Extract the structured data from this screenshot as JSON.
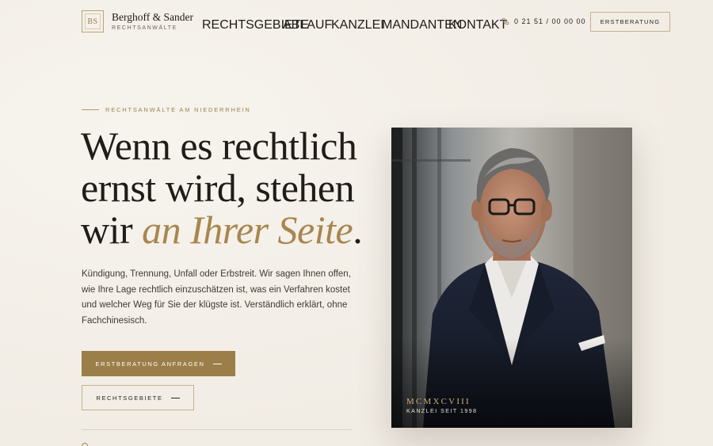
{
  "brand": {
    "monogram": "BS",
    "name": "Berghoff & Sander",
    "tagline": "RECHTSANWÄLTE"
  },
  "nav": {
    "items": [
      {
        "label": "RECHTSGEBIETE"
      },
      {
        "label": "ABLAUF"
      },
      {
        "label": "KANZLEI"
      },
      {
        "label": "MANDANTEN"
      },
      {
        "label": "KONTAKT"
      }
    ],
    "phone_icon": "phone-icon",
    "phone": "0 21 51 / 00 00 00",
    "cta_label": "ERSTBERATUNG"
  },
  "hero": {
    "eyebrow": "RECHTSANWÄLTE AM NIEDERRHEIN",
    "headline_line1": "Wenn es rechtlich",
    "headline_line2": "ernst wird, stehen",
    "headline_line3_start": "wir ",
    "headline_accent": "an Ihrer Seite",
    "headline_end": ".",
    "lead": "Kündigung, Trennung, Unfall oder Erbstreit. Wir sagen Ihnen offen, wie Ihre Lage rechtlich einzuschätzen ist, was ein Verfahren kostet und welcher Weg für Sie der klügste ist. Verständlich erklärt, ohne Fachchinesisch.",
    "primary_button": "ERSTBERATUNG ANFRAGEN",
    "secondary_button": "RECHTSGEBIETE"
  },
  "portrait": {
    "roman_year": "MCMXCVIII",
    "since_label": "KANZLEI SEIT 1998"
  },
  "colors": {
    "accent": "#9b7e48",
    "accent_text": "#a8864e",
    "background": "#f4f0e9",
    "text": "#1f1c19"
  }
}
